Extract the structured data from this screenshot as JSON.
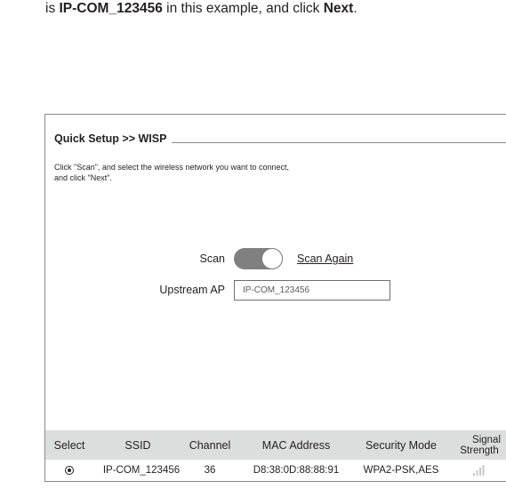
{
  "instruction": {
    "prefix": "is ",
    "ssid": "IP-COM_123456",
    "middle": " in this example, and click ",
    "next": "Next",
    "suffix": "."
  },
  "panel": {
    "title": "Quick Setup >> WISP",
    "description_line1": "Click \"Scan\", and select the wireless network you want to connect,",
    "description_line2": "and click \"Next\"."
  },
  "scan": {
    "label": "Scan",
    "toggle_on": true,
    "scan_again": "Scan Again"
  },
  "upstream": {
    "label": "Upstream AP",
    "value": "IP-COM_123456"
  },
  "table": {
    "headers": {
      "select": "Select",
      "ssid": "SSID",
      "channel": "Channel",
      "mac": "MAC Address",
      "security": "Security Mode",
      "signal_line1": "Signal",
      "signal_line2": "Strength"
    },
    "rows": [
      {
        "selected": true,
        "ssid": "IP-COM_123456",
        "channel": "36",
        "mac": "D8:38:0D:88:88:91",
        "security": "WPA2-PSK,AES",
        "signal_bars": 4
      }
    ]
  },
  "colors": {
    "toggle_on": "#808080",
    "header_bg": "#dcdddd",
    "signal_bar": "#c8c9ca"
  }
}
